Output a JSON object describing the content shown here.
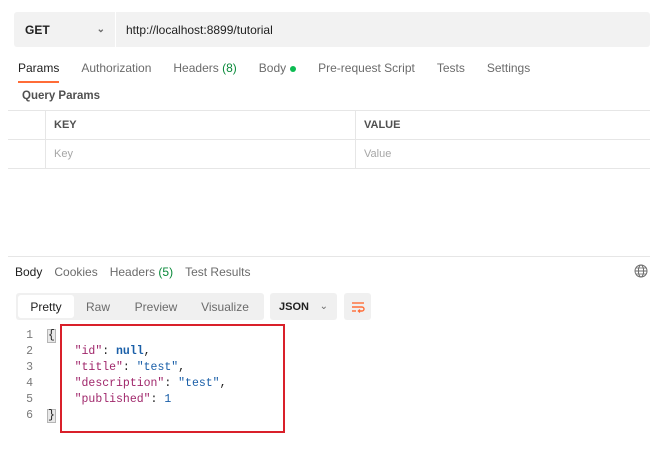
{
  "request": {
    "method": "GET",
    "url": "http://localhost:8899/tutorial"
  },
  "request_tabs": [
    {
      "label": "Params",
      "active": true
    },
    {
      "label": "Authorization"
    },
    {
      "label": "Headers",
      "count": "(8)"
    },
    {
      "label": "Body",
      "dot": true
    },
    {
      "label": "Pre-request Script"
    },
    {
      "label": "Tests"
    },
    {
      "label": "Settings"
    }
  ],
  "query_params": {
    "title": "Query Params",
    "col_key": "KEY",
    "col_value": "VALUE",
    "key_placeholder": "Key",
    "value_placeholder": "Value"
  },
  "response_tabs": [
    {
      "label": "Body",
      "active": true
    },
    {
      "label": "Cookies"
    },
    {
      "label": "Headers",
      "count": "(5)"
    },
    {
      "label": "Test Results"
    }
  ],
  "view_modes": [
    "Pretty",
    "Raw",
    "Preview",
    "Visualize"
  ],
  "active_view": "Pretty",
  "format": "JSON",
  "icons": {
    "method_dropdown": "chevron-down-icon",
    "globe": "globe-icon",
    "wrap": "wrap-lines-icon"
  },
  "colors": {
    "accent": "#ff6c37",
    "highlight_box": "#d9202a",
    "dot": "#0cbb52"
  },
  "response_body": {
    "line_numbers": [
      "1",
      "2",
      "3",
      "4",
      "5",
      "6"
    ],
    "open": "{",
    "close": "}",
    "fields": [
      {
        "key": "\"id\"",
        "value": "null",
        "sep": ","
      },
      {
        "key": "\"title\"",
        "value": "\"test\"",
        "sep": ","
      },
      {
        "key": "\"description\"",
        "value": "\"test\"",
        "sep": ","
      },
      {
        "key": "\"published\"",
        "value": "1",
        "sep": ""
      }
    ]
  }
}
